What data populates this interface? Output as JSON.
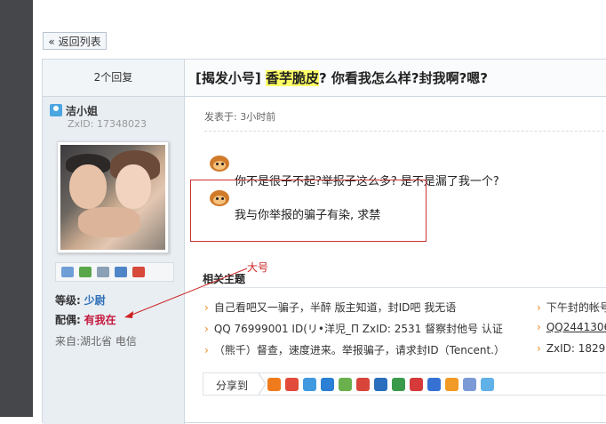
{
  "back_button": {
    "label": "« 返回列表"
  },
  "sidebar": {
    "reply_count": "2个回复",
    "username": "洁小姐",
    "zxid": "ZxID:  17348023",
    "rank_label": "等级:",
    "rank_value": "少尉",
    "spouse_label": "配偶:",
    "spouse_value": "有我在",
    "from": "来自:湖北省 电信",
    "action_icons": [
      "mail-icon",
      "add-friend-icon",
      "profile-icon",
      "card-icon",
      "blocks-icon"
    ]
  },
  "post": {
    "title_prefix": "[揭发小号]",
    "title_highlight": "香芋脆皮",
    "title_rest": "? 你看我怎么样?封我啊?嗯?",
    "posted": "发表于: 3小时前",
    "line1": "你不是很子不起?举报子这么多? 是不是漏了我一个?",
    "line2": "我与你举报的骗子有染, 求禁",
    "annotation": "大号"
  },
  "related": {
    "title": "相关主题",
    "left_items": [
      "自己看吧又一骗子，半醉 版主知道，封ID吧  我无语",
      "QQ 76999001  ID(リ•洋児_П   ZxID: 2531   督察封他号  认证",
      "（熊千）督查，速度进来。举报骗子，请求封ID（Tencent.）"
    ],
    "right_items": [
      "下午封的帐号",
      "QQ2441306",
      "ZxID: 1829"
    ]
  },
  "share": {
    "label": "分享到",
    "icon_names": [
      "qzone-icon",
      "weibo-icon",
      "tencent-weibo-icon",
      "pengyou-icon",
      "qq-icon",
      "kaixin-icon",
      "renren-icon",
      "douban-icon",
      "sohu-icon",
      "baidu-icon",
      "feixin-icon",
      "favorite-icon",
      "note-icon"
    ],
    "icon_colors": [
      "#f07b1d",
      "#e24b3b",
      "#3f9ae0",
      "#2b7fd4",
      "#6ab04c",
      "#d9453b",
      "#2a6ebd",
      "#3b9a4a",
      "#d63a3a",
      "#3672d4",
      "#f19a25",
      "#7c9bd6",
      "#5fb1e8"
    ]
  },
  "colors": {
    "highlight": "#ffff66",
    "rank": "#2b6db8",
    "spouse": "#c4163c",
    "annotation": "#cc2222"
  }
}
